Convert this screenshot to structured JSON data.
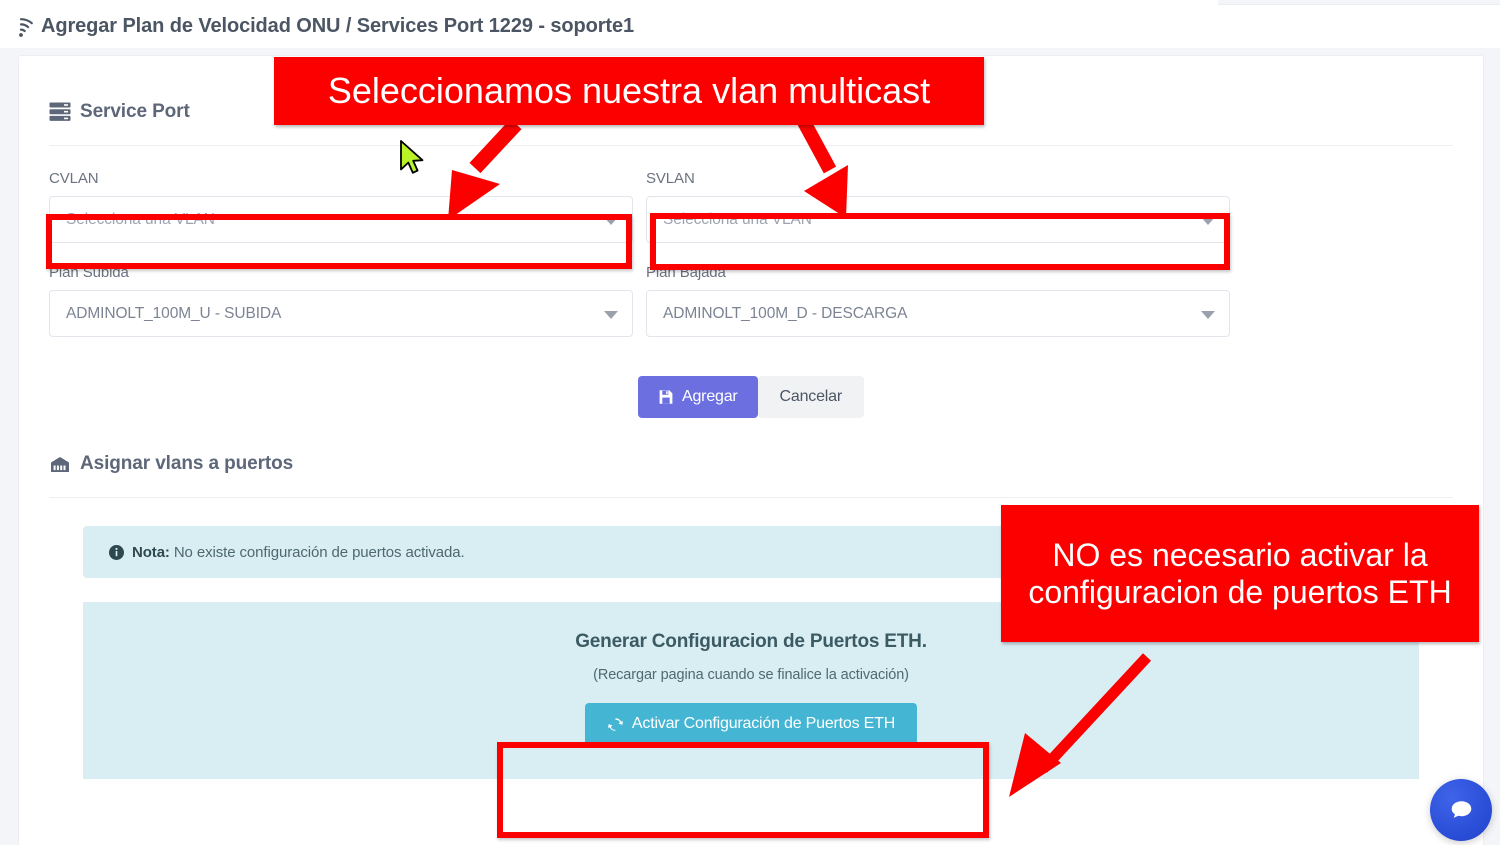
{
  "header": {
    "icon": "wifi-icon",
    "title": "Agregar Plan de Velocidad ONU / Services Port 1229 - soporte1"
  },
  "service_port_section": {
    "icon": "server-stack-icon",
    "title": "Service Port",
    "fields": [
      {
        "label": "CVLAN",
        "value": "Selecciona una VLAN",
        "is_placeholder": true,
        "highlighted": true
      },
      {
        "label": "SVLAN",
        "value": "Selecciona una VLAN",
        "is_placeholder": true,
        "highlighted": true
      },
      {
        "label": "Plan Subida",
        "value": "ADMINOLT_100M_U - SUBIDA",
        "is_placeholder": false,
        "highlighted": false
      },
      {
        "label": "Plan Bajada",
        "value": "ADMINOLT_100M_D - DESCARGA",
        "is_placeholder": false,
        "highlighted": false
      }
    ],
    "buttons": {
      "submit_label": "Agregar",
      "submit_icon": "save-icon",
      "cancel_label": "Cancelar"
    }
  },
  "ports_section": {
    "icon": "ethernet-port-icon",
    "title": "Asignar vlans a puertos",
    "note": {
      "icon": "info-circle-icon",
      "label": "Nota:",
      "text": "No existe configuración de puertos activada."
    },
    "activation_panel": {
      "title": "Generar Configuracion de Puertos ETH.",
      "subtitle": "(Recargar pagina cuando se finalice la activación)",
      "button_label": "Activar Configuración de Puertos ETH",
      "button_icon": "refresh-icon"
    }
  },
  "annotations": [
    {
      "id": "annotation-vlan",
      "text": "Seleccionamos nuestra vlan multicast",
      "color": "#fc0000",
      "text_color": "#ffffff"
    },
    {
      "id": "annotation-eth",
      "text": "NO es necesario activar la configuracion de puertos ETH",
      "color": "#fc0000",
      "text_color": "#ffffff"
    }
  ],
  "chat_widget": {
    "icon": "chat-bubble-icon",
    "color": "#2b4fd8"
  },
  "colors": {
    "primary_button": "#6b6fe0",
    "activate_button": "#45b5d4",
    "info_panel": "#d9eef3",
    "annotation_red": "#fc0000",
    "page_background": "#f4f5f9"
  }
}
